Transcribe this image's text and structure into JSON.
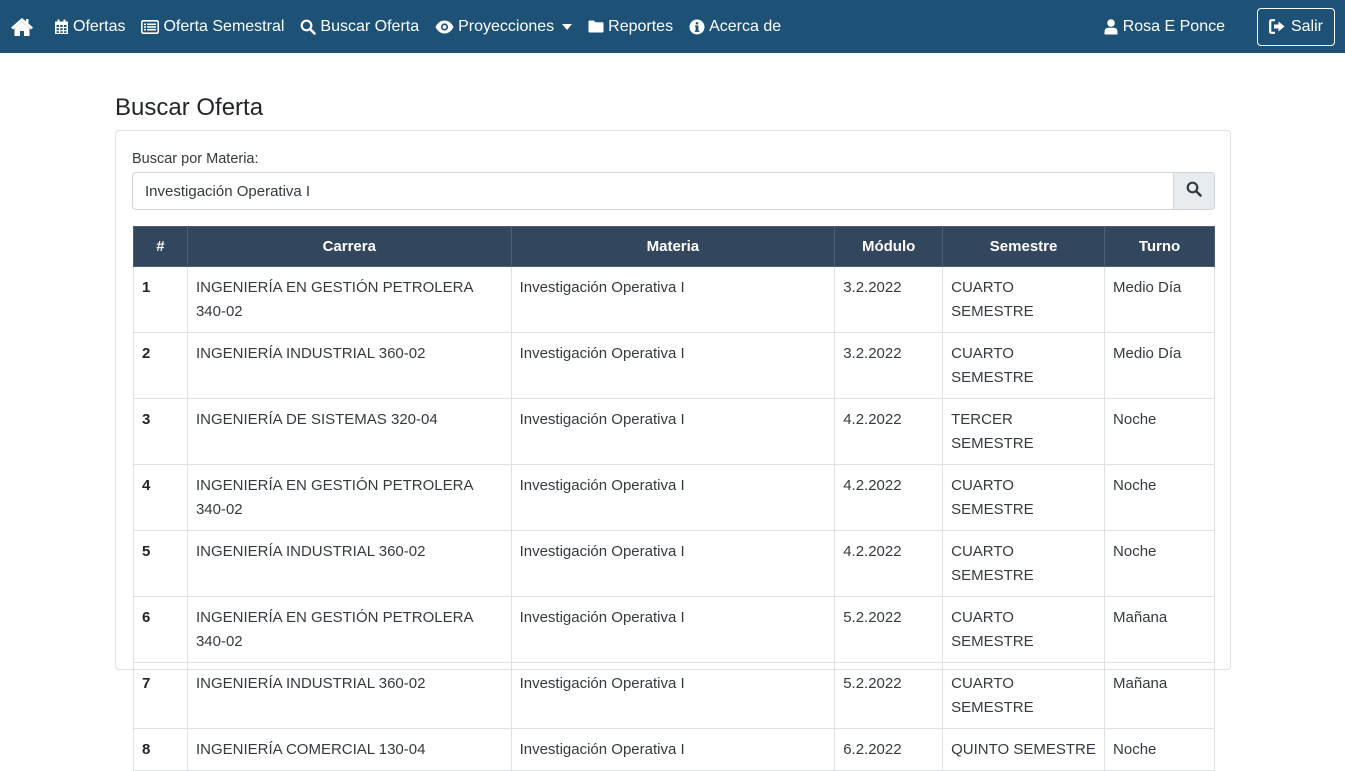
{
  "navbar": {
    "items": [
      {
        "label": "Ofertas",
        "icon": "calendar-icon"
      },
      {
        "label": "Oferta Semestral",
        "icon": "list-card-icon"
      },
      {
        "label": "Buscar Oferta",
        "icon": "search-icon"
      },
      {
        "label": "Proyecciones",
        "icon": "eye-icon"
      },
      {
        "label": "Reportes",
        "icon": "folder-icon"
      },
      {
        "label": "Acerca de",
        "icon": "info-icon"
      }
    ],
    "user_name": "Rosa E Ponce",
    "logout_label": "Salir",
    "bg_color": "#1d5276"
  },
  "page": {
    "title": "Buscar Oferta",
    "search_label": "Buscar por Materia:",
    "search_value": "Investigación Operativa I"
  },
  "table": {
    "headers": [
      "#",
      "Carrera",
      "Materia",
      "Módulo",
      "Semestre",
      "Turno"
    ],
    "header_color": "#32475e",
    "rows": [
      {
        "n": "1",
        "carrera": "INGENIERÍA EN GESTIÓN PETROLERA 340-02",
        "materia": "Investigación Operativa I",
        "modulo": "3.2.2022",
        "semestre": "CUARTO SEMESTRE",
        "turno": "Medio Día"
      },
      {
        "n": "2",
        "carrera": "INGENIERÍA INDUSTRIAL 360-02",
        "materia": "Investigación Operativa I",
        "modulo": "3.2.2022",
        "semestre": "CUARTO SEMESTRE",
        "turno": "Medio Día"
      },
      {
        "n": "3",
        "carrera": "INGENIERÍA DE SISTEMAS 320-04",
        "materia": "Investigación Operativa I",
        "modulo": "4.2.2022",
        "semestre": "TERCER SEMESTRE",
        "turno": "Noche"
      },
      {
        "n": "4",
        "carrera": "INGENIERÍA EN GESTIÓN PETROLERA 340-02",
        "materia": "Investigación Operativa I",
        "modulo": "4.2.2022",
        "semestre": "CUARTO SEMESTRE",
        "turno": "Noche"
      },
      {
        "n": "5",
        "carrera": "INGENIERÍA INDUSTRIAL 360-02",
        "materia": "Investigación Operativa I",
        "modulo": "4.2.2022",
        "semestre": "CUARTO SEMESTRE",
        "turno": "Noche"
      },
      {
        "n": "6",
        "carrera": "INGENIERÍA EN GESTIÓN PETROLERA 340-02",
        "materia": "Investigación Operativa I",
        "modulo": "5.2.2022",
        "semestre": "CUARTO SEMESTRE",
        "turno": "Mañana"
      },
      {
        "n": "7",
        "carrera": "INGENIERÍA INDUSTRIAL 360-02",
        "materia": "Investigación Operativa I",
        "modulo": "5.2.2022",
        "semestre": "CUARTO SEMESTRE",
        "turno": "Mañana"
      },
      {
        "n": "8",
        "carrera": "INGENIERÍA COMERCIAL 130-04",
        "materia": "Investigación Operativa I",
        "modulo": "6.2.2022",
        "semestre": "QUINTO SEMESTRE",
        "turno": "Noche"
      }
    ]
  }
}
